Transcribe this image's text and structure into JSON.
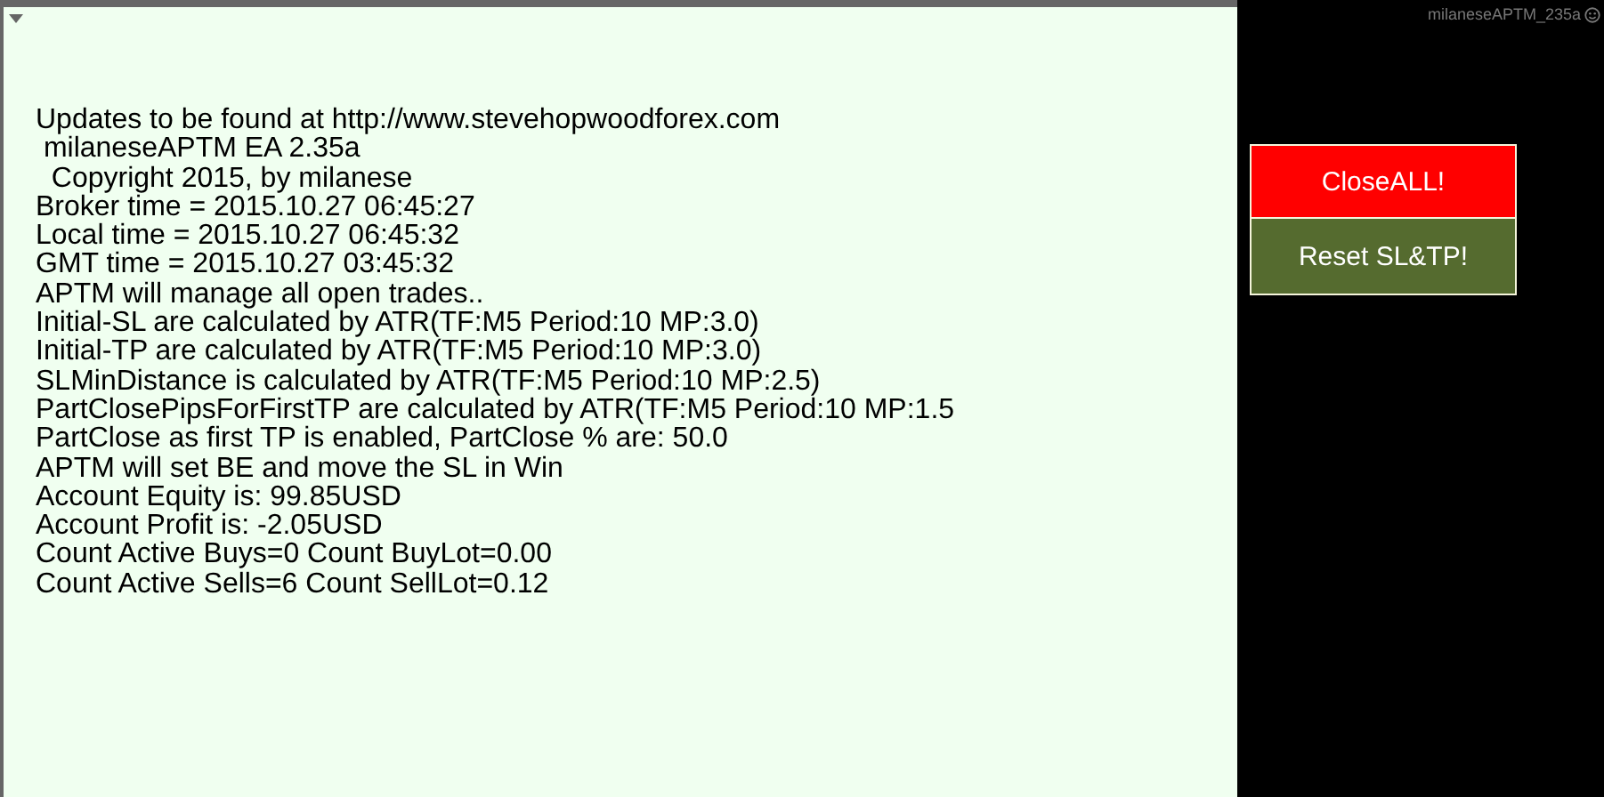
{
  "info_lines": [
    "Updates to be found at http://www.stevehopwoodforex.com",
    " milaneseAPTM EA 2.35a",
    "  Copyright 2015, by milanese",
    "Broker time = 2015.10.27 06:45:27",
    "Local time = 2015.10.27 06:45:32",
    "GMT time = 2015.10.27 03:45:32",
    "APTM will manage all open trades..",
    "Initial-SL are calculated by ATR(TF:M5 Period:10 MP:3.0)",
    "Initial-TP are calculated by ATR(TF:M5 Period:10 MP:3.0)",
    "SLMinDistance is calculated by ATR(TF:M5 Period:10 MP:2.5)",
    "PartClosePipsForFirstTP are calculated by ATR(TF:M5 Period:10 MP:1.5",
    "PartClose as first TP is enabled, PartClose % are: 50.0",
    "APTM will set BE and move the SL in Win",
    "Account Equity is: 99.85USD",
    "Account Profit is: -2.05USD",
    "Count Active Buys=0 Count BuyLot=0.00",
    "Count Active Sells=6 Count SellLot=0.12"
  ],
  "chart_label": "milaneseAPTM_235a",
  "buttons": [
    {
      "label": "CloseALL!",
      "color": "#ff0000"
    },
    {
      "label": "Reset SL&TP!",
      "color": "#556b2f"
    }
  ]
}
